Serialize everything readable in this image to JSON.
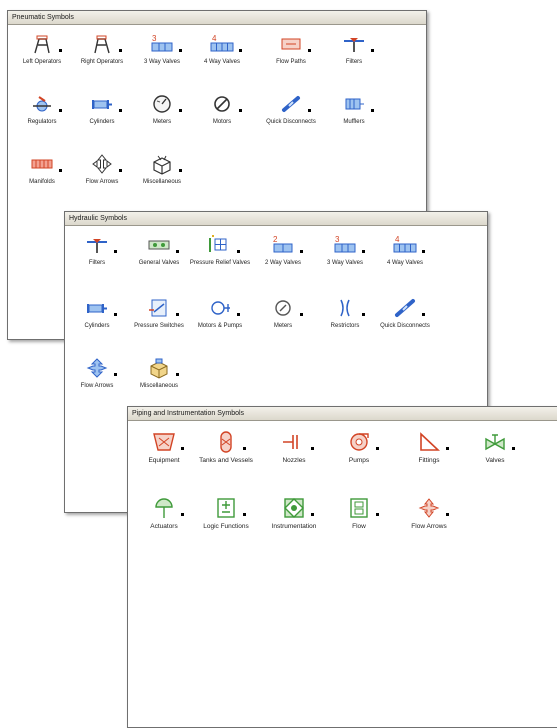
{
  "colors": {
    "accent_blue": "#2f63c8",
    "accent_red": "#d24425",
    "accent_green": "#3f9a3a"
  },
  "pneumatic": {
    "title": "Pneumatic Symbols",
    "items": [
      {
        "label": "Left Operators",
        "icon": "left-operator-icon"
      },
      {
        "label": "Right Operators",
        "icon": "right-operator-icon"
      },
      {
        "label": "3 Way Valves",
        "icon": "three-way-valve-icon",
        "badge": "3"
      },
      {
        "label": "4 Way Valves",
        "icon": "four-way-valve-icon",
        "badge": "4"
      },
      {
        "label": "Flow Paths",
        "icon": "flow-path-icon"
      },
      {
        "label": "Filters",
        "icon": "filter-icon"
      },
      {
        "label": "Regulators",
        "icon": "regulator-icon"
      },
      {
        "label": "Cylinders",
        "icon": "cylinder-icon"
      },
      {
        "label": "Meters",
        "icon": "meter-icon"
      },
      {
        "label": "Motors",
        "icon": "motor-icon"
      },
      {
        "label": "Quick Disconnects",
        "icon": "quick-disconnect-icon"
      },
      {
        "label": "Mufflers",
        "icon": "muffler-icon"
      },
      {
        "label": "Manifolds",
        "icon": "manifold-icon"
      },
      {
        "label": "Flow Arrows",
        "icon": "flow-arrow-icon"
      },
      {
        "label": "Miscellaneous",
        "icon": "miscellaneous-icon"
      }
    ]
  },
  "hydraulic": {
    "title": "Hydraulic Symbols",
    "items": [
      {
        "label": "Filters",
        "icon": "filter-icon"
      },
      {
        "label": "General Valves",
        "icon": "general-valve-icon"
      },
      {
        "label": "Pressure Relief Valves",
        "icon": "pressure-relief-valve-icon"
      },
      {
        "label": "2 Way Valves",
        "icon": "two-way-valve-icon",
        "badge": "2"
      },
      {
        "label": "3 Way Valves",
        "icon": "three-way-valve-icon",
        "badge": "3"
      },
      {
        "label": "4 Way Valves",
        "icon": "four-way-valve-icon",
        "badge": "4"
      },
      {
        "label": "Cylinders",
        "icon": "cylinder-icon"
      },
      {
        "label": "Pressure Switches",
        "icon": "pressure-switch-icon"
      },
      {
        "label": "Motors & Pumps",
        "icon": "motor-pump-icon"
      },
      {
        "label": "Meters",
        "icon": "meter-icon"
      },
      {
        "label": "Restrictors",
        "icon": "restrictor-icon"
      },
      {
        "label": "Quick Disconnects",
        "icon": "quick-disconnect-icon"
      },
      {
        "label": "Flow Arrows",
        "icon": "flow-arrow-icon"
      },
      {
        "label": "Miscellaneous",
        "icon": "miscellaneous-icon"
      }
    ]
  },
  "piping": {
    "title": "Piping and Instrumentation Symbols",
    "items": [
      {
        "label": "Equipment",
        "icon": "equipment-icon"
      },
      {
        "label": "Tanks and Vessels",
        "icon": "tank-vessel-icon"
      },
      {
        "label": "Nozzles",
        "icon": "nozzle-icon"
      },
      {
        "label": "Pumps",
        "icon": "pump-icon"
      },
      {
        "label": "Fittings",
        "icon": "fitting-icon"
      },
      {
        "label": "Valves",
        "icon": "valve-icon"
      },
      {
        "label": "Actuators",
        "icon": "actuator-icon"
      },
      {
        "label": "Logic Functions",
        "icon": "logic-function-icon"
      },
      {
        "label": "Instrumentation",
        "icon": "instrumentation-icon"
      },
      {
        "label": "Flow",
        "icon": "flow-icon"
      },
      {
        "label": "Flow Arrows",
        "icon": "flow-arrow-icon"
      }
    ]
  }
}
